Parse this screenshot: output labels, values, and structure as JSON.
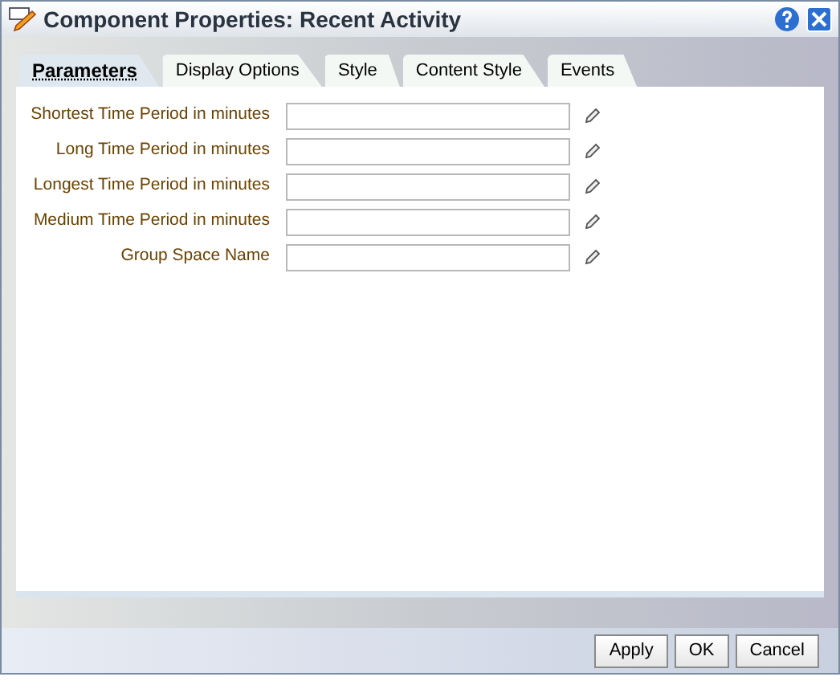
{
  "window": {
    "title": "Component Properties: Recent Activity"
  },
  "tabs": [
    {
      "label": "Parameters",
      "selected": true
    },
    {
      "label": "Display Options",
      "selected": false
    },
    {
      "label": "Style",
      "selected": false
    },
    {
      "label": "Content Style",
      "selected": false
    },
    {
      "label": "Events",
      "selected": false
    }
  ],
  "fields": [
    {
      "label": "Shortest Time Period in minutes"
    },
    {
      "label": "Long Time Period in minutes"
    },
    {
      "label": "Longest Time Period in minutes"
    },
    {
      "label": "Medium Time Period in minutes"
    },
    {
      "label": "Group Space Name"
    }
  ],
  "buttons": [
    "Apply",
    "OK",
    "Cancel"
  ]
}
